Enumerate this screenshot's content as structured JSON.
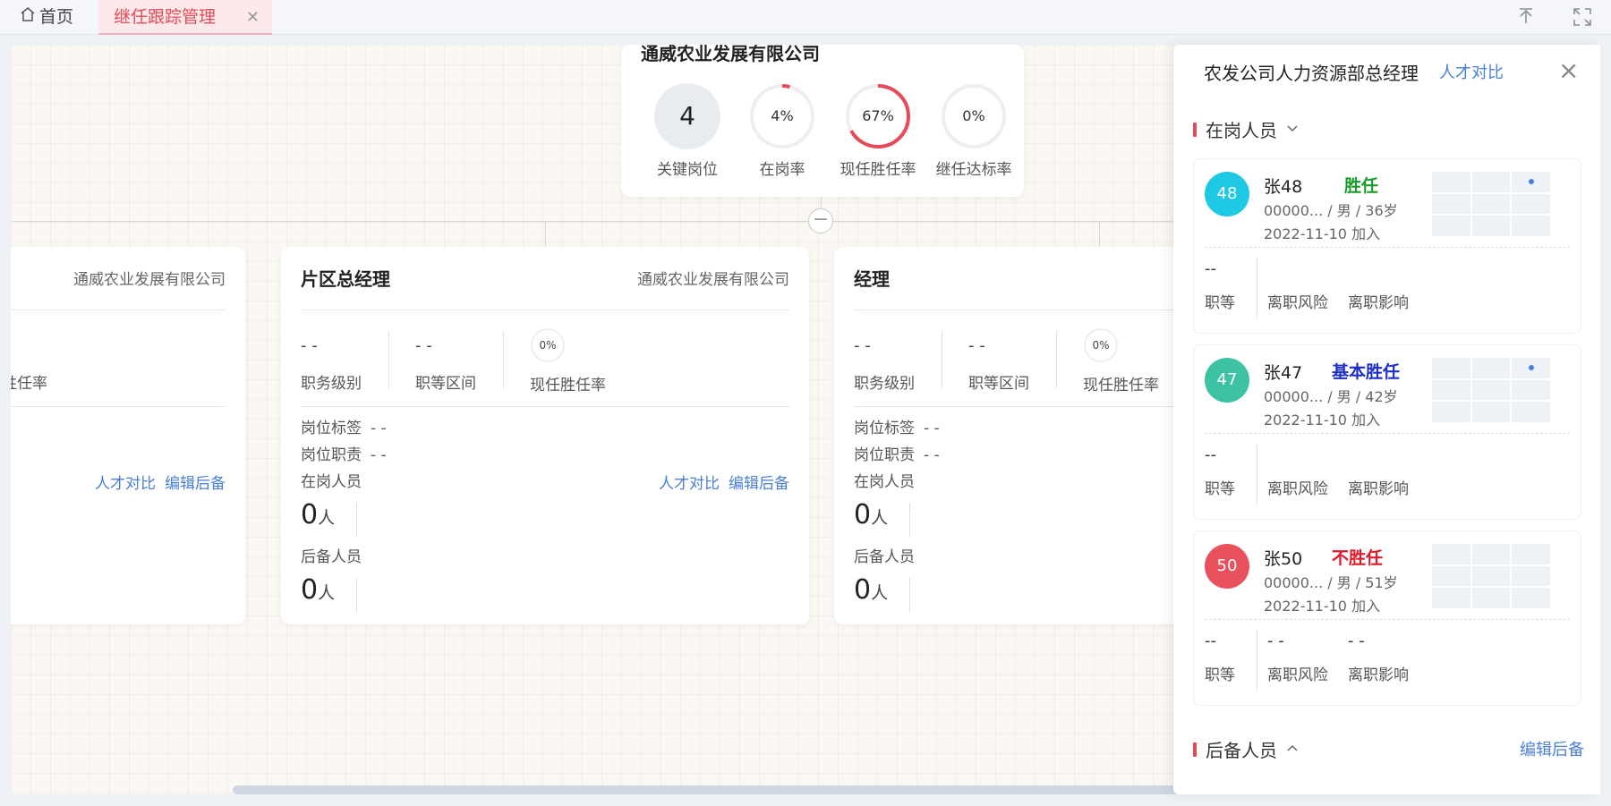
{
  "tabs": {
    "home": "首页",
    "active": "继任跟踪管理"
  },
  "root": {
    "company": "通威农业发展有限公司",
    "key_positions": {
      "value": "4",
      "label": "关键岗位"
    },
    "metrics": [
      {
        "value": "4%",
        "label": "在岗率",
        "percent": 4
      },
      {
        "value": "67%",
        "label": "现任胜任率",
        "percent": 67
      },
      {
        "value": "0%",
        "label": "继任达标率",
        "percent": 0
      }
    ]
  },
  "cards": [
    {
      "company": "通威农业发展有限公司",
      "partial_stat_label": "胜任率",
      "links": {
        "compare": "人才对比",
        "edit": "编辑后备"
      }
    },
    {
      "title": "片区总经理",
      "company": "通威农业发展有限公司",
      "grade": "- -",
      "grade_label": "职务级别",
      "range": "- -",
      "range_label": "职等区间",
      "rate": "0%",
      "rate_label": "现任胜任率",
      "tag_label": "岗位标签",
      "tag_value": "- -",
      "duty_label": "岗位职责",
      "duty_value": "- -",
      "incumbent_label": "在岗人员",
      "incumbent_count": "0",
      "backup_label": "后备人员",
      "backup_count": "0",
      "unit": "人",
      "links": {
        "compare": "人才对比",
        "edit": "编辑后备"
      }
    },
    {
      "title": "经理",
      "grade": "- -",
      "grade_label": "职务级别",
      "range": "- -",
      "range_label": "职等区间",
      "rate": "0%",
      "rate_label": "现任胜任率",
      "tag_label": "岗位标签",
      "tag_value": "- -",
      "duty_label": "岗位职责",
      "duty_value": "- -",
      "incumbent_label": "在岗人员",
      "incumbent_count": "0",
      "backup_label": "后备人员",
      "backup_count": "0",
      "unit": "人"
    }
  ],
  "drawer": {
    "title": "农发公司人力资源部总经理",
    "compare": "人才对比",
    "incumbent_section": "在岗人员",
    "backup_section": "后备人员",
    "edit_backup": "编辑后备",
    "people": [
      {
        "avatar": "48",
        "avatar_color": "#1fc8e3",
        "name": "张48",
        "evaluation": "胜任",
        "eval_color": "#1a9a2c",
        "info": "00000... / 男 / 36岁",
        "date": "2022-11-10 加入",
        "grade": "--",
        "grade_label": "职等",
        "risk": "",
        "risk_label": "离职风险",
        "impact": "",
        "impact_label": "离职影响",
        "dot_cell": 2
      },
      {
        "avatar": "47",
        "avatar_color": "#3dc2a4",
        "name": "张47",
        "evaluation": "基本胜任",
        "eval_color": "#1d2fc8",
        "info": "00000... / 男 / 42岁",
        "date": "2022-11-10 加入",
        "grade": "--",
        "grade_label": "职等",
        "risk": "",
        "risk_label": "离职风险",
        "impact": "",
        "impact_label": "离职影响",
        "dot_cell": 2
      },
      {
        "avatar": "50",
        "avatar_color": "#e8505b",
        "name": "张50",
        "evaluation": "不胜任",
        "eval_color": "#e0192a",
        "info": "00000... / 男 / 51岁",
        "date": "2022-11-10 加入",
        "grade": "--",
        "grade_label": "职等",
        "risk": "- -",
        "risk_label": "离职风险",
        "impact": "- -",
        "impact_label": "离职影响",
        "dot_cell": -1
      }
    ]
  }
}
